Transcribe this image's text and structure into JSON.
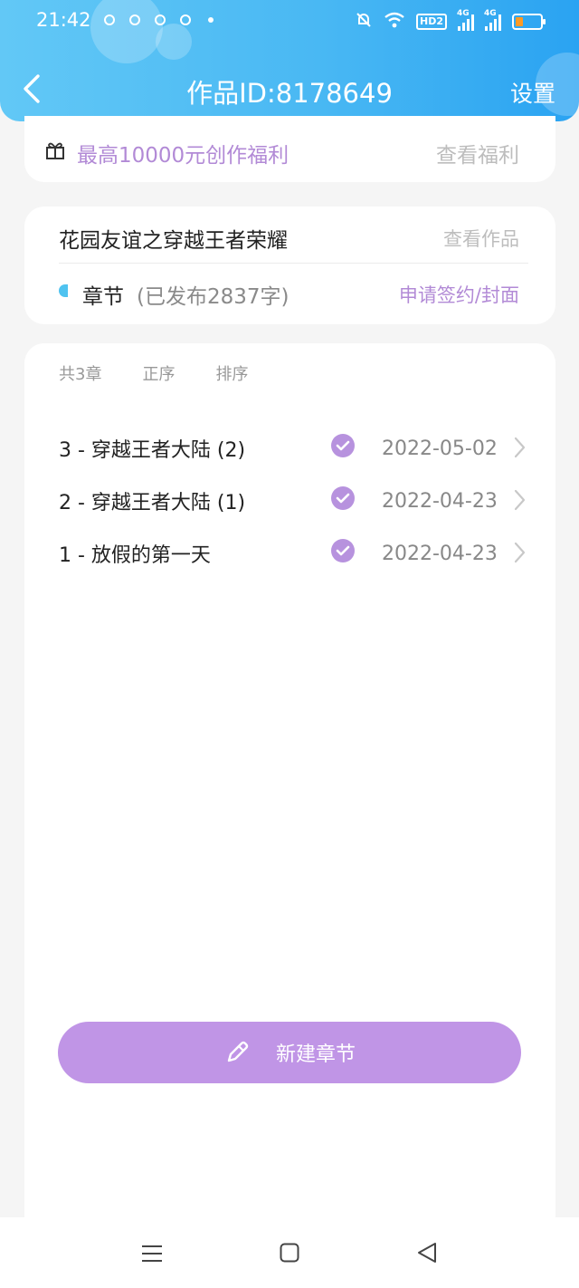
{
  "status_bar": {
    "time": "21:42",
    "hd_badge": "HD2",
    "network_1": "4G",
    "network_2": "4G"
  },
  "header": {
    "title": "作品ID:8178649",
    "settings_label": "设置"
  },
  "benefit": {
    "text": "最高10000元创作福利",
    "link": "查看福利"
  },
  "work": {
    "title": "花园友谊之穿越王者荣耀",
    "view_link": "查看作品",
    "chapter_label": "章节",
    "chapter_meta": "(已发布2837字)",
    "sign_link": "申请签约/封面"
  },
  "list": {
    "count_label": "共3章",
    "order_label": "正序",
    "sort_label": "排序",
    "items": [
      {
        "title": "3 - 穿越王者大陆 (2)",
        "date": "2022-05-02"
      },
      {
        "title": "2 - 穿越王者大陆 (1)",
        "date": "2022-04-23"
      },
      {
        "title": "1 - 放假的第一天",
        "date": "2022-04-23"
      }
    ]
  },
  "new_chapter_label": "新建章节",
  "colors": {
    "header_start": "#62c8f6",
    "header_end": "#2aa3f2",
    "accent_purple": "#b28ad6",
    "button_purple": "#c095e6"
  },
  "icons": [
    "back-icon",
    "gift-icon",
    "check-icon",
    "chevron-right-icon",
    "pencil-icon",
    "menu-icon",
    "home-icon",
    "nav-back-icon"
  ]
}
